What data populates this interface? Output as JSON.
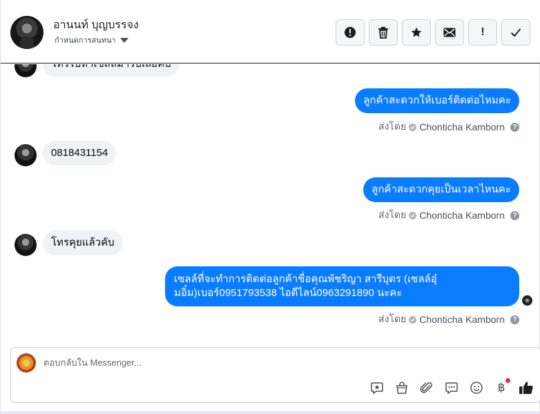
{
  "header": {
    "contact_name": "อานนท์ บุญบรรจง",
    "status_label": "กำหนดการสนทนา",
    "actions": [
      {
        "name": "mark-spam-button",
        "icon": "alert-circle-icon"
      },
      {
        "name": "delete-button",
        "icon": "trash-icon"
      },
      {
        "name": "star-button",
        "icon": "star-icon"
      },
      {
        "name": "mark-unread-button",
        "icon": "envelope-icon"
      },
      {
        "name": "follow-up-button",
        "icon": "exclamation-icon",
        "label": "!"
      },
      {
        "name": "mark-done-button",
        "icon": "checkmark-icon"
      }
    ]
  },
  "messages": [
    {
      "direction": "in",
      "text": "โทรไปหาเซลล์มารับเลยคับ"
    },
    {
      "direction": "out",
      "text": "ลูกค้าสะดวกให้เบอร์ติดต่อไหมคะ",
      "sent_by_label": "ส่งโดย",
      "agent": "Chonticha Kamborn"
    },
    {
      "direction": "in",
      "text": "0818431154"
    },
    {
      "direction": "out",
      "text": "ลูกค้าสะดวกคุยเป็นเวลาไหนคะ",
      "sent_by_label": "ส่งโดย",
      "agent": "Chonticha Kamborn"
    },
    {
      "direction": "in",
      "text": "โทรคุยแล้วคับ"
    },
    {
      "direction": "out",
      "text": "เซลล์ที่จะทำการติดต่อลูกค้าชื่อคุณพัชริญา สารีบุตร (เซลล์อุ๋มอิ๋ม)เบอร์0951793538 ไอดีไลน์0963291890 นะคะ",
      "sent_by_label": "ส่งโดย",
      "agent": "Chonticha Kamborn"
    }
  ],
  "composer": {
    "placeholder": "ตอบกลับใน Messenger...",
    "tools": [
      "saved-reply-icon",
      "shopping-bag-icon",
      "paperclip-icon",
      "speech-bubble-icon",
      "smiley-icon",
      "baht-payment-icon",
      "thumbs-up-icon"
    ],
    "baht_symbol": "฿"
  },
  "colors": {
    "outgoing_bubble": "#0a7cff",
    "incoming_bubble": "#f0f2f5",
    "notification_dot": "#f02849"
  }
}
